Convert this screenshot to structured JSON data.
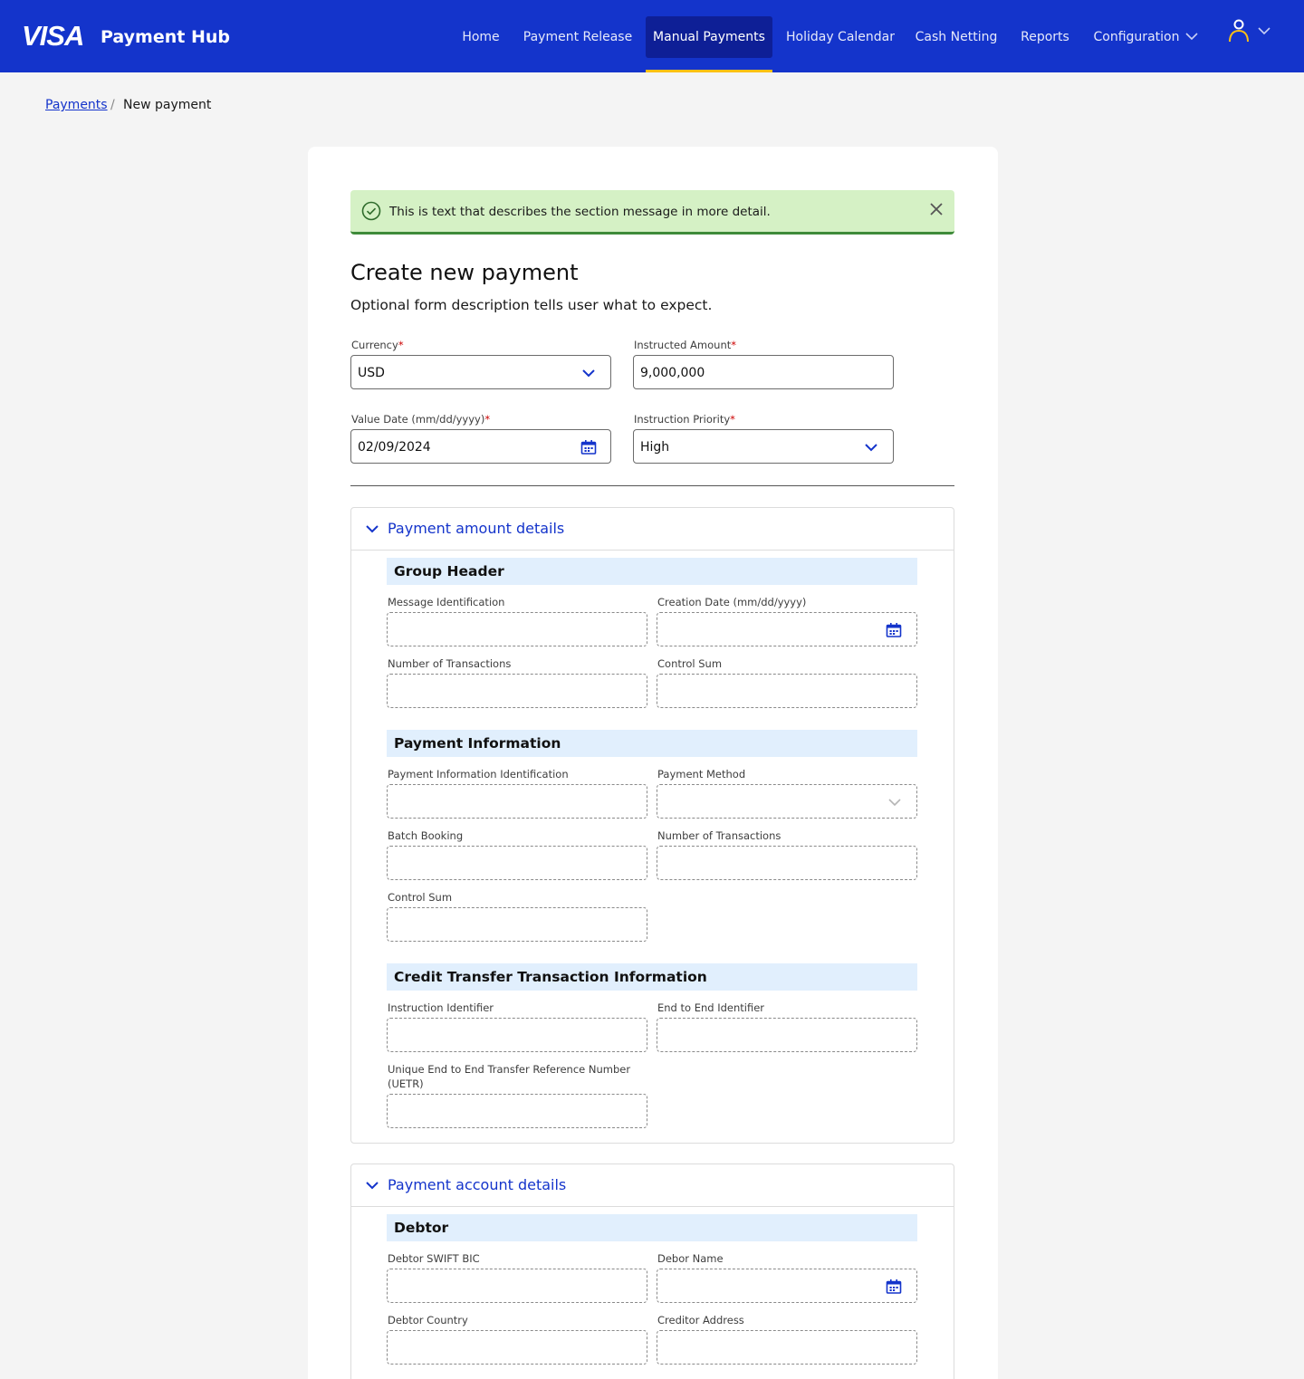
{
  "header": {
    "logo": "VISA",
    "app_title": "Payment Hub",
    "nav": [
      "Home",
      "Payment Release",
      "Manual Payments",
      "Holiday Calendar",
      "Cash Netting",
      "Reports",
      "Configuration"
    ],
    "active_nav": "Manual Payments"
  },
  "breadcrumb": {
    "parent": "Payments",
    "separator": "/",
    "current": "New payment"
  },
  "alert": {
    "text": "This is text that describes the section message in more detail.",
    "icon": "check-circle-icon"
  },
  "form": {
    "title": "Create new payment",
    "description": "Optional form description tells user what to expect.",
    "currency": {
      "label": "Currency",
      "value": "USD"
    },
    "amount": {
      "label": "Instructed Amount",
      "value": "9,000,000"
    },
    "value_date": {
      "label": "Value Date (mm/dd/yyyy)",
      "value": "02/09/2024"
    },
    "priority": {
      "label": "Instruction Priority",
      "value": "High"
    },
    "required_mark": "*"
  },
  "panels": {
    "amount": {
      "title": "Payment amount details",
      "group_header": {
        "title": "Group Header",
        "message_id": "Message Identification",
        "creation_date": "Creation Date (mm/dd/yyyy)",
        "num_tx": "Number of Transactions",
        "control_sum": "Control Sum"
      },
      "payment_info": {
        "title": "Payment Information",
        "pi_id": "Payment Information Identification",
        "method": "Payment Method",
        "batch": "Batch Booking",
        "num_tx": "Number of Transactions",
        "control_sum": "Control Sum"
      },
      "credit_transfer": {
        "title": "Credit Transfer Transaction Information",
        "instr_id": "Instruction Identifier",
        "e2e_id": "End to End Identifier",
        "uetr_line1": "Unique End to End Transfer Reference Number",
        "uetr_line2": "(UETR)"
      }
    },
    "account": {
      "title": "Payment account details",
      "debtor": {
        "title": "Debtor",
        "swift": "Debtor SWIFT BIC",
        "name": "Debor Name",
        "country": "Debtor Country",
        "address": "Creditor Address"
      }
    }
  },
  "colors": {
    "brand": "#1434cb",
    "accent": "#fcc015",
    "success_bg": "#d5f1c5",
    "group_bg": "#e1effd"
  }
}
